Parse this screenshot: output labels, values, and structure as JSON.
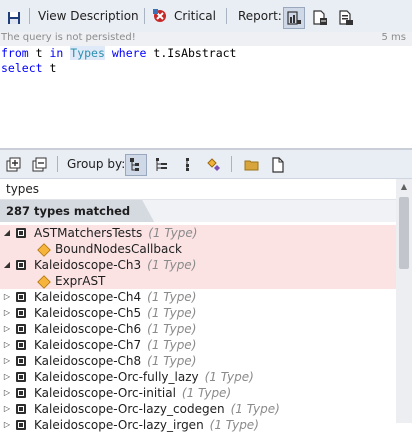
{
  "toolbar": {
    "view_description": "View Description",
    "critical": "Critical",
    "report": "Report:"
  },
  "status": {
    "message": "The query is not persisted!",
    "time": "5 ms"
  },
  "editor": {
    "line1": {
      "from": "from",
      "t1": " t ",
      "in": "in",
      "sp1": " ",
      "types": "Types",
      "sp2": " ",
      "where": "where",
      "rest": " t.IsAbstract"
    },
    "line2": {
      "select": "select",
      "rest": " t"
    }
  },
  "results_toolbar": {
    "group_by": "Group by:"
  },
  "search": {
    "value": "types"
  },
  "results": {
    "header": "287 types matched",
    "rows": [
      {
        "name": "ASTMatchersTests",
        "count": "(1 Type)"
      },
      {
        "name": "BoundNodesCallback",
        "count": ""
      },
      {
        "name": "Kaleidoscope-Ch3",
        "count": "(1 Type)"
      },
      {
        "name": "ExprAST",
        "count": ""
      },
      {
        "name": "Kaleidoscope-Ch4",
        "count": "(1 Type)"
      },
      {
        "name": "Kaleidoscope-Ch5",
        "count": "(1 Type)"
      },
      {
        "name": "Kaleidoscope-Ch6",
        "count": "(1 Type)"
      },
      {
        "name": "Kaleidoscope-Ch7",
        "count": "(1 Type)"
      },
      {
        "name": "Kaleidoscope-Ch8",
        "count": "(1 Type)"
      },
      {
        "name": "Kaleidoscope-Orc-fully_lazy",
        "count": "(1 Type)"
      },
      {
        "name": "Kaleidoscope-Orc-initial",
        "count": "(1 Type)"
      },
      {
        "name": "Kaleidoscope-Orc-lazy_codegen",
        "count": "(1 Type)"
      },
      {
        "name": "Kaleidoscope-Orc-lazy_irgen",
        "count": "(1 Type)"
      }
    ]
  },
  "colors": {
    "highlight_row": "#fbe3e4",
    "keyword": "#0000ff",
    "type_name": "#2b91af"
  }
}
